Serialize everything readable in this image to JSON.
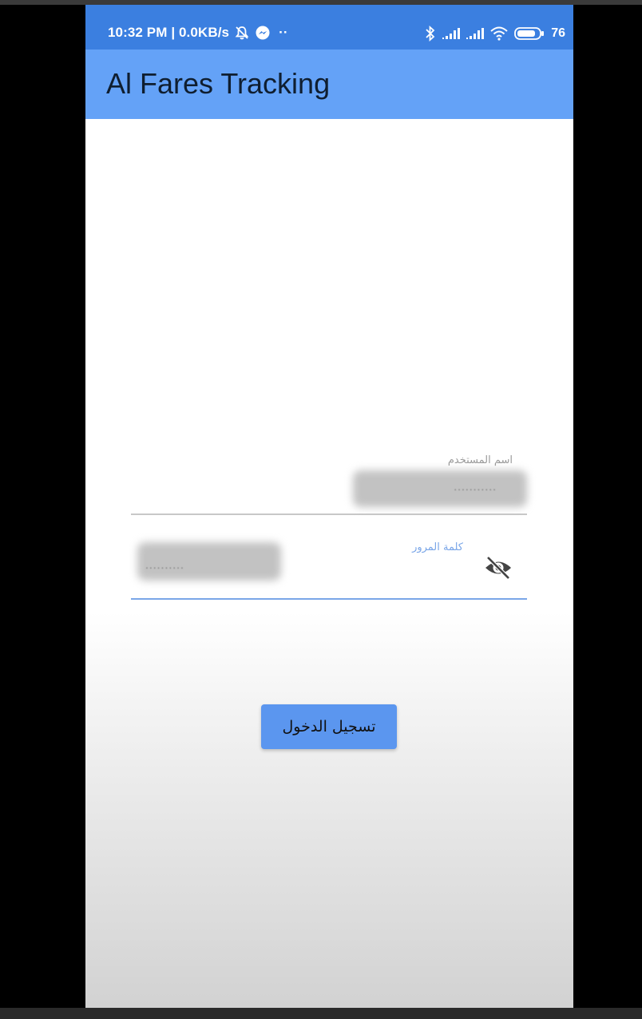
{
  "status_bar": {
    "time_info": "10:32 PM | 0.0KB/s",
    "more": "··",
    "battery_level": "76",
    "icons": [
      "mute-bell-icon",
      "messenger-icon",
      "bluetooth-icon",
      "signal-icon",
      "signal-icon",
      "wifi-icon",
      "battery-icon"
    ]
  },
  "app_bar": {
    "title": "Al Fares Tracking"
  },
  "login_form": {
    "username": {
      "label": "اسم المستخدم",
      "value": "..........."
    },
    "password": {
      "label": "كلمة المرور",
      "value": "..........",
      "visibility_icon": "eye-off-icon"
    },
    "submit_label": "تسجيل الدخول"
  },
  "colors": {
    "status_bar": "#3b7fe0",
    "app_bar": "#64a2f7",
    "button": "#5b96ef",
    "focused_underline": "#7aa6e8"
  }
}
